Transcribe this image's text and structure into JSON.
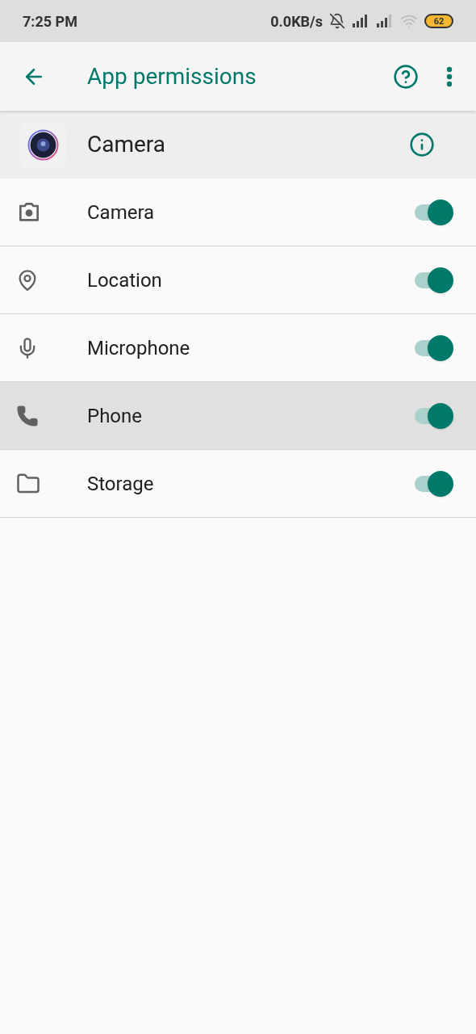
{
  "status_bar": {
    "time": "7:25 PM",
    "speed": "0.0KB/s",
    "battery": "62"
  },
  "toolbar": {
    "title": "App permissions"
  },
  "app": {
    "name": "Camera"
  },
  "permissions": [
    {
      "kind": "camera",
      "label": "Camera",
      "on": true,
      "selected": false
    },
    {
      "kind": "location",
      "label": "Location",
      "on": true,
      "selected": false
    },
    {
      "kind": "microphone",
      "label": "Microphone",
      "on": true,
      "selected": false
    },
    {
      "kind": "phone",
      "label": "Phone",
      "on": true,
      "selected": true
    },
    {
      "kind": "storage",
      "label": "Storage",
      "on": true,
      "selected": false
    }
  ]
}
